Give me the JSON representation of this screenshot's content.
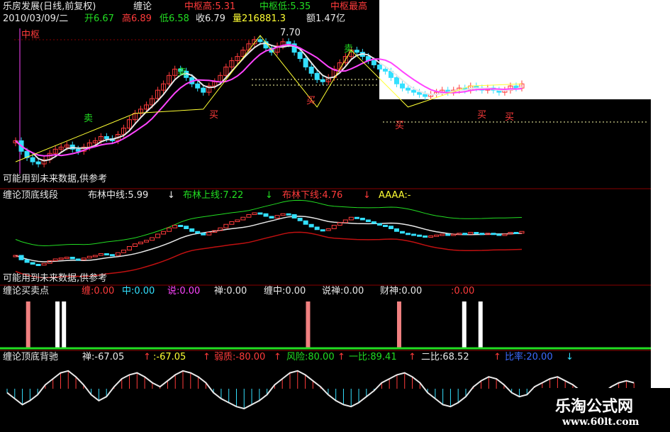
{
  "colors": {
    "bg": "#000000",
    "up": "#ff3b3b",
    "down": "#33e0ff",
    "white": "#e8e8e8",
    "yellow": "#ffff33",
    "magenta": "#ff44ff",
    "green": "#22dd22",
    "darkred": "#c01010",
    "grid": "#8a0000"
  },
  "panel1": {
    "title": "乐房发展(日线,前复权)",
    "indicator": "缠论",
    "zg_high": "中枢高:5.31",
    "zg_low": "中枢低:5.35",
    "zg_extra": "中枢最高",
    "date": "2010/03/09/二",
    "open": "开6.67",
    "high": "高6.89",
    "low": "低6.58",
    "close": "收6.79",
    "vol": "量216881.3",
    "amount": "额1.47亿",
    "zhongshu_tag": "中枢",
    "peak_price": "7.70",
    "sell_mark": "卖",
    "buy_mark": "买",
    "footer": "可能用到未来数据,供参考"
  },
  "panel2": {
    "title": "缠论顶底线段",
    "mid": "布林中线:5.99",
    "upper": "布林上线:7.22",
    "lower": "布林下线:4.76",
    "aaaa": "AAAA:-",
    "footer": "可能用到未来数据,供参考"
  },
  "panel3": {
    "title": "缠论买卖点",
    "chan": "缠:0.00",
    "zhong": "中:0.00",
    "shuo": "说:0.00",
    "chan2": "禅:0.00",
    "chanzhong": "缠中:0.00",
    "shuochan": "说禅:0.00",
    "caishen": "财神:0.00",
    "last": ":0.00"
  },
  "panel4": {
    "title": "缠论顶底背驰",
    "chan": "禅:-67.05",
    "v2": ":-67.05",
    "weak": "弱质:-80.00",
    "risk": "风险:80.00",
    "yibi": "一比:89.41",
    "erbi": "二比:68.52",
    "last": "比率:20.00"
  },
  "watermark": {
    "name": "乐淘公式网",
    "url": "www.60lt.com"
  },
  "chart_data": {
    "type": "line",
    "kline_closes": [
      5.2,
      4.95,
      4.8,
      4.7,
      4.65,
      4.75,
      4.9,
      5.0,
      5.05,
      5.1,
      5.0,
      4.95,
      5.05,
      5.15,
      5.2,
      5.3,
      5.25,
      5.2,
      5.35,
      5.5,
      5.7,
      5.85,
      5.95,
      6.05,
      6.2,
      6.4,
      6.55,
      6.75,
      6.9,
      6.85,
      6.7,
      6.55,
      6.45,
      6.35,
      6.5,
      6.6,
      6.75,
      6.95,
      7.1,
      7.2,
      7.35,
      7.5,
      7.6,
      7.55,
      7.4,
      7.3,
      7.45,
      7.55,
      7.5,
      7.3,
      7.15,
      6.95,
      6.8,
      6.65,
      6.6,
      6.7,
      6.9,
      7.05,
      7.2,
      7.35,
      7.3,
      7.2,
      7.1,
      7.0,
      6.9,
      6.85,
      6.7,
      6.55,
      6.45,
      6.4,
      6.35,
      6.3,
      6.25,
      6.3,
      6.35,
      6.4,
      6.35,
      6.4,
      6.45,
      6.4,
      6.5,
      6.45,
      6.4,
      6.45,
      6.4,
      6.35,
      6.4,
      6.5,
      6.45,
      6.55
    ],
    "boll_upper": 7.22,
    "boll_mid": 5.99,
    "boll_lower": 4.76,
    "signal_bars": [
      {
        "pos": 0.04,
        "color": "red"
      },
      {
        "pos": 0.085,
        "color": "white"
      },
      {
        "pos": 0.095,
        "color": "white"
      },
      {
        "pos": 0.47,
        "color": "red"
      },
      {
        "pos": 0.61,
        "color": "red"
      },
      {
        "pos": 0.71,
        "color": "white"
      },
      {
        "pos": 0.735,
        "color": "white"
      }
    ],
    "histogram": [
      -0.2,
      -0.5,
      -0.8,
      -0.6,
      -0.3,
      0.2,
      0.5,
      0.8,
      0.9,
      0.6,
      0.2,
      -0.3,
      -0.6,
      -0.4,
      0.1,
      0.5,
      0.7,
      0.8,
      0.6,
      0.3,
      0.1,
      0.4,
      0.7,
      0.9,
      0.8,
      0.6,
      0.3,
      -0.2,
      -0.5,
      -0.7,
      -0.9,
      -1.0,
      -0.8,
      -0.6,
      -0.3,
      0.2,
      0.5,
      0.8,
      0.9,
      0.7,
      0.4,
      0.1,
      -0.3,
      -0.6,
      -0.8,
      -0.9,
      -0.7,
      -0.4,
      -0.1,
      0.3,
      0.5,
      0.7,
      0.8,
      0.6,
      0.3,
      -0.2,
      -0.5,
      -0.8,
      -0.9,
      -0.7,
      -0.4,
      0.1,
      0.4,
      0.6,
      0.5,
      0.2,
      -0.2,
      -0.4,
      -0.3,
      0.1,
      0.3,
      0.5,
      0.6,
      0.4,
      0.2,
      -0.1,
      -0.3,
      -0.4,
      -0.2,
      0.1,
      0.3,
      0.4,
      0.3
    ]
  }
}
